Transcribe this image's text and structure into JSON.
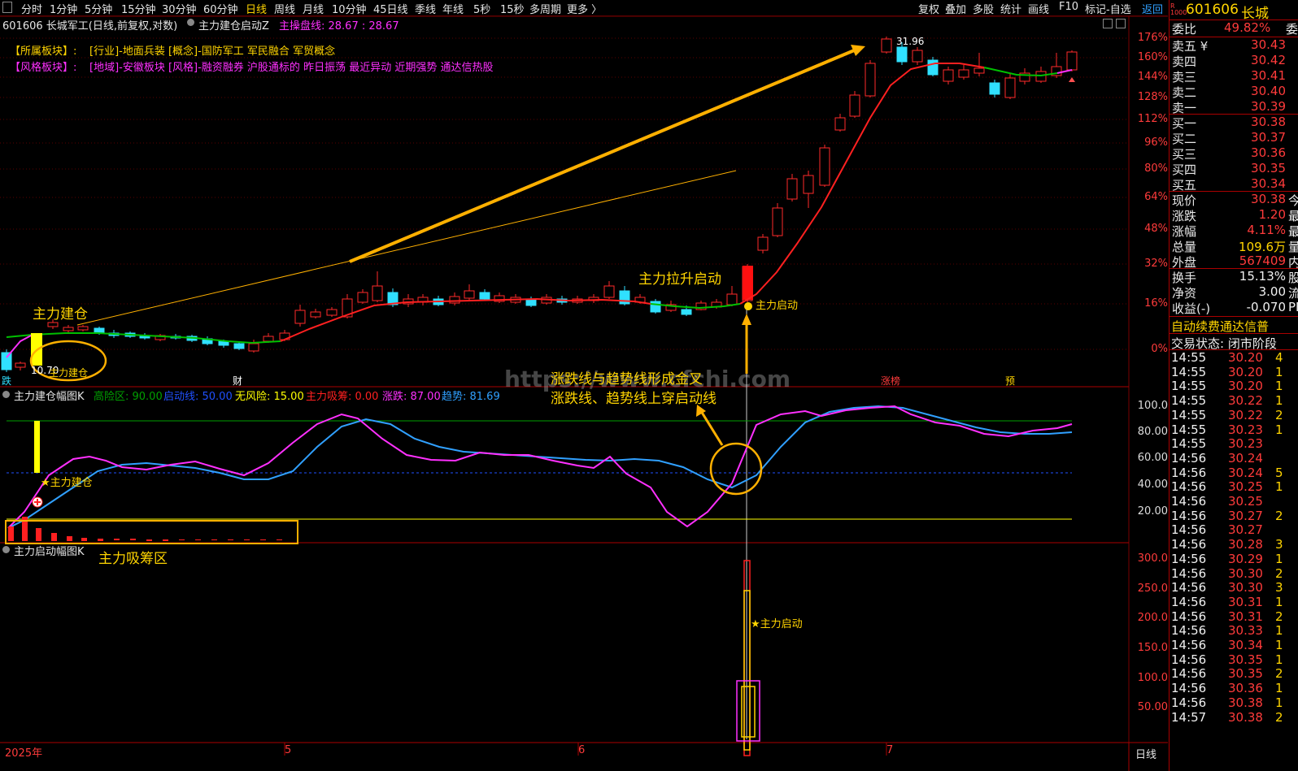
{
  "toolbar": {
    "timeframes": [
      "分时",
      "1分钟",
      "5分钟",
      "15分钟",
      "30分钟",
      "60分钟",
      "日线",
      "周线",
      "月线",
      "10分钟",
      "45日线",
      "季线",
      "年线",
      "5秒",
      "15秒",
      "多周期",
      "更多 〉"
    ],
    "active": "日线",
    "right_items": [
      "复权",
      "叠加",
      "多股",
      "统计",
      "画线",
      "F10",
      "标记-自选",
      "返回"
    ]
  },
  "chart_header": {
    "symbol_title": "601606 长城军工(日线,前复权,对数)",
    "indicator_name": "主力建仓启动Z",
    "cost_label": "主操盘线: 28.67 : 28.67"
  },
  "sector_info": {
    "sector_tag": "【所属板块】:",
    "sector_value": "[行业]-地面兵装 [概念]-国防军工 军民融合 军贸概念",
    "style_tag": "【风格板块】:",
    "style_value": "[地域]-安徽板块 [风格]-融资融券 沪股通标的 昨日振荡 最近异动 近期强势 通达信热股"
  },
  "annotations": {
    "build_position": "主力建仓",
    "build_position_small": "主力建仓",
    "price_low": "10.70",
    "price_high": "31.96",
    "lift_start": "主力拉升启动",
    "main_start": "主力启动",
    "golden_cross": "涨跌线与趋势线形成金叉",
    "cross_above": "涨跌线、趋势线上穿启动线",
    "absorb_zone": "主力吸筹区",
    "star_build": "★主力建仓",
    "star_start": "★主力启动",
    "watermark": "https://www.cfchi.com",
    "event_die": "跌",
    "event_cai": "财",
    "event_zhangbang": "涨榜",
    "event_yu": "预"
  },
  "price_axis": [
    "176%",
    "160%",
    "144%",
    "128%",
    "112%",
    "96%",
    "80%",
    "64%",
    "48%",
    "32%",
    "16%",
    "0%"
  ],
  "indicator1": {
    "name": "主力建仓幅图K",
    "params": [
      {
        "label": "高险区: 90.00",
        "color": "#00a000"
      },
      {
        "label": "启动线: 50.00",
        "color": "#2050ff"
      },
      {
        "label": "无风险: 15.00",
        "color": "#ffff00"
      },
      {
        "label": "主力吸筹: 0.00",
        "color": "#ff2020"
      },
      {
        "label": "涨跌: 87.00",
        "color": "#ff30ff"
      },
      {
        "label": "趋势: 81.69",
        "color": "#30a0ff"
      }
    ],
    "axis": [
      "100.0",
      "80.00",
      "60.00",
      "40.00",
      "20.00"
    ]
  },
  "indicator2": {
    "name": "主力启动幅图K",
    "axis": [
      "300.0",
      "250.0",
      "200.0",
      "150.0",
      "100.0",
      "50.00"
    ]
  },
  "date_axis": [
    "2025年",
    "5",
    "6",
    "7"
  ],
  "date_axis_right": "日线",
  "quote": {
    "code": "601606",
    "name": "长城",
    "webi": {
      "label": "委比",
      "value": "49.82%",
      "extra": "委"
    },
    "asks": [
      {
        "label": "卖五 ¥",
        "value": "30.43"
      },
      {
        "label": "卖四",
        "value": "30.42"
      },
      {
        "label": "卖三",
        "value": "30.41"
      },
      {
        "label": "卖二",
        "value": "30.40"
      },
      {
        "label": "卖一",
        "value": "30.39"
      }
    ],
    "bids": [
      {
        "label": "买一",
        "value": "30.38"
      },
      {
        "label": "买二",
        "value": "30.37"
      },
      {
        "label": "买三",
        "value": "30.36"
      },
      {
        "label": "买四",
        "value": "30.35"
      },
      {
        "label": "买五",
        "value": "30.34"
      }
    ],
    "stats": [
      {
        "label": "现价",
        "value": "30.38",
        "extra": "今",
        "color": "#ff3b3b"
      },
      {
        "label": "涨跌",
        "value": "1.20",
        "extra": "最",
        "color": "#ff3b3b"
      },
      {
        "label": "涨幅",
        "value": "4.11%",
        "extra": "最",
        "color": "#ff3b3b"
      },
      {
        "label": "总量",
        "value": "109.6万",
        "extra": "量",
        "color": "#ffd400"
      },
      {
        "label": "外盘",
        "value": "567409",
        "extra": "内",
        "color": "#ff3b3b"
      }
    ],
    "stats2": [
      {
        "label": "换手",
        "value": "15.13%",
        "extra": "股",
        "color": "#f0f0f0"
      },
      {
        "label": "净资",
        "value": "3.00",
        "extra": "流",
        "color": "#f0f0f0"
      },
      {
        "label": "收益(-)",
        "value": "-0.070",
        "extra": "PE",
        "color": "#f0f0f0"
      }
    ],
    "notice": "自动续费通达信普",
    "trade_status": "交易状态: 闭市阶段",
    "ticks": [
      {
        "t": "14:55",
        "p": "30.20",
        "v": "4"
      },
      {
        "t": "14:55",
        "p": "30.20",
        "v": "1"
      },
      {
        "t": "14:55",
        "p": "30.20",
        "v": "1"
      },
      {
        "t": "14:55",
        "p": "30.22",
        "v": "1"
      },
      {
        "t": "14:55",
        "p": "30.22",
        "v": "2"
      },
      {
        "t": "14:55",
        "p": "30.23",
        "v": "1"
      },
      {
        "t": "14:55",
        "p": "30.23",
        "v": ""
      },
      {
        "t": "14:56",
        "p": "30.24",
        "v": ""
      },
      {
        "t": "14:56",
        "p": "30.24",
        "v": "5"
      },
      {
        "t": "14:56",
        "p": "30.25",
        "v": "1"
      },
      {
        "t": "14:56",
        "p": "30.25",
        "v": ""
      },
      {
        "t": "14:56",
        "p": "30.27",
        "v": "2"
      },
      {
        "t": "14:56",
        "p": "30.27",
        "v": ""
      },
      {
        "t": "14:56",
        "p": "30.28",
        "v": "3"
      },
      {
        "t": "14:56",
        "p": "30.29",
        "v": "1"
      },
      {
        "t": "14:56",
        "p": "30.30",
        "v": "2"
      },
      {
        "t": "14:56",
        "p": "30.30",
        "v": "3"
      },
      {
        "t": "14:56",
        "p": "30.31",
        "v": "1"
      },
      {
        "t": "14:56",
        "p": "30.31",
        "v": "2"
      },
      {
        "t": "14:56",
        "p": "30.33",
        "v": "1"
      },
      {
        "t": "14:56",
        "p": "30.34",
        "v": "1"
      },
      {
        "t": "14:56",
        "p": "30.35",
        "v": "1"
      },
      {
        "t": "14:56",
        "p": "30.35",
        "v": "2"
      },
      {
        "t": "14:56",
        "p": "30.36",
        "v": "1"
      },
      {
        "t": "14:56",
        "p": "30.38",
        "v": "1"
      },
      {
        "t": "14:57",
        "p": "30.38",
        "v": "2"
      }
    ]
  }
}
